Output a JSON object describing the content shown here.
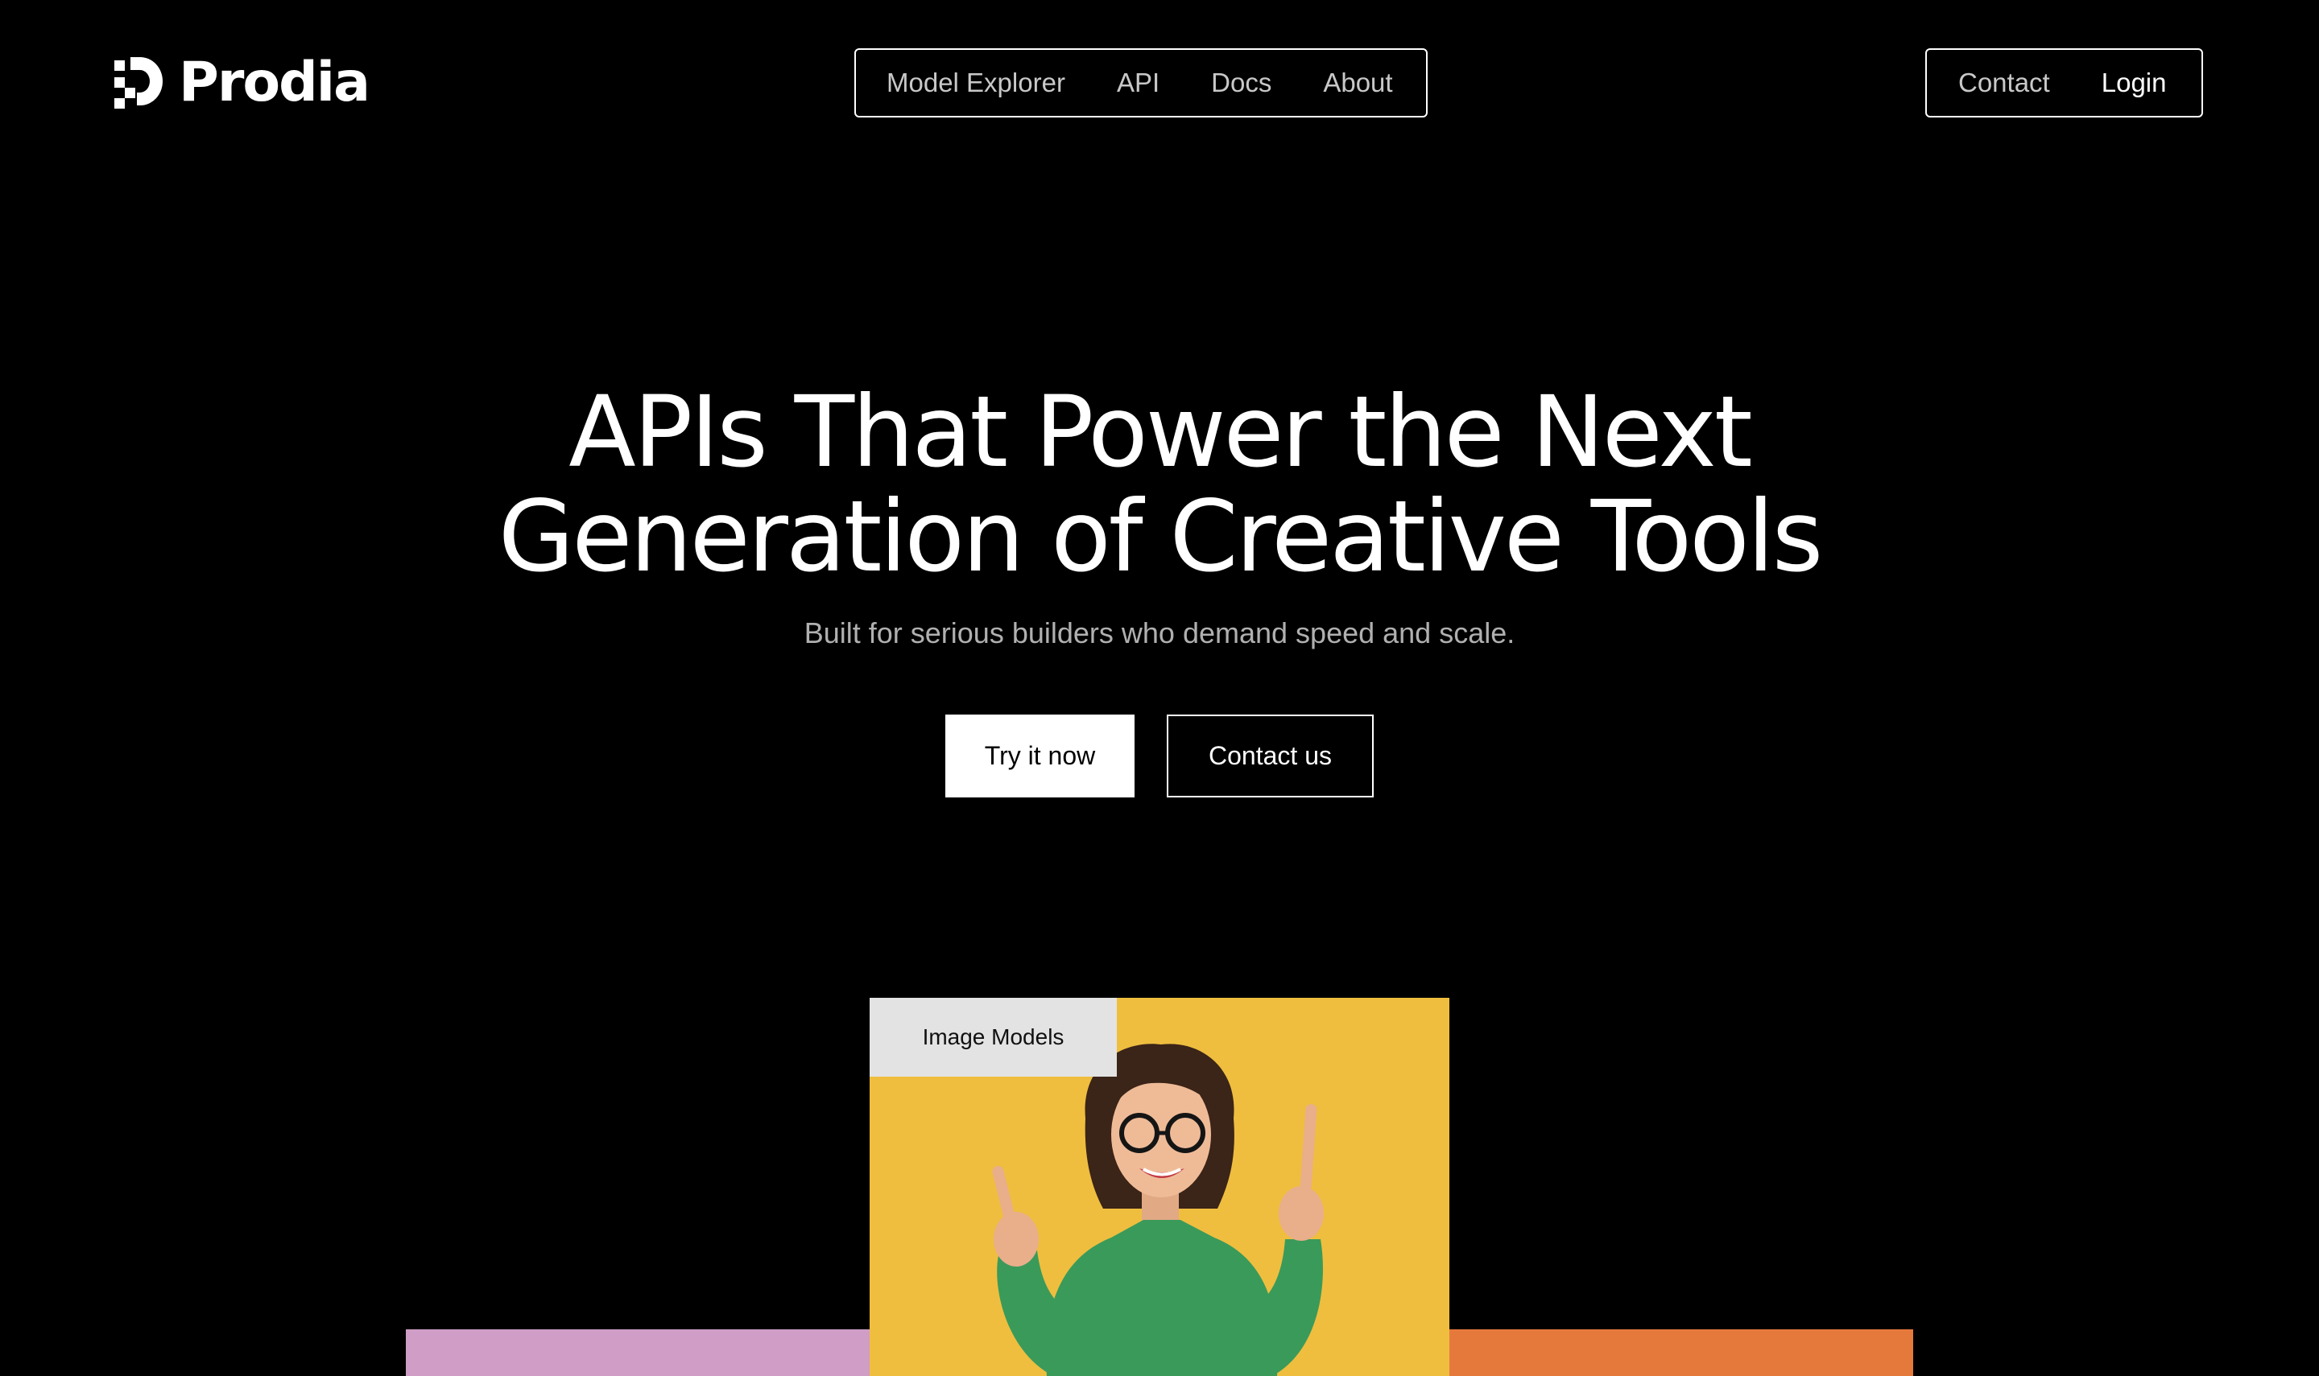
{
  "brand": {
    "name": "Prodia",
    "logo_icon": "prodia-logo-icon"
  },
  "nav": {
    "items": [
      {
        "label": "Model Explorer"
      },
      {
        "label": "API"
      },
      {
        "label": "Docs"
      },
      {
        "label": "About"
      }
    ]
  },
  "account_nav": {
    "contact_label": "Contact",
    "login_label": "Login"
  },
  "hero": {
    "title_line1": "APIs That Power the Next",
    "title_line2": "Generation of Creative Tools",
    "subtitle": "Built for serious builders who demand speed and scale.",
    "primary_cta": "Try it now",
    "secondary_cta": "Contact us"
  },
  "showcase": {
    "featured_tag": "Image Models",
    "colors": {
      "left_card": "#cf9dc6",
      "center_card": "#efbe3f",
      "right_card": "#e5793c",
      "sweater": "#3a9a5a"
    }
  }
}
